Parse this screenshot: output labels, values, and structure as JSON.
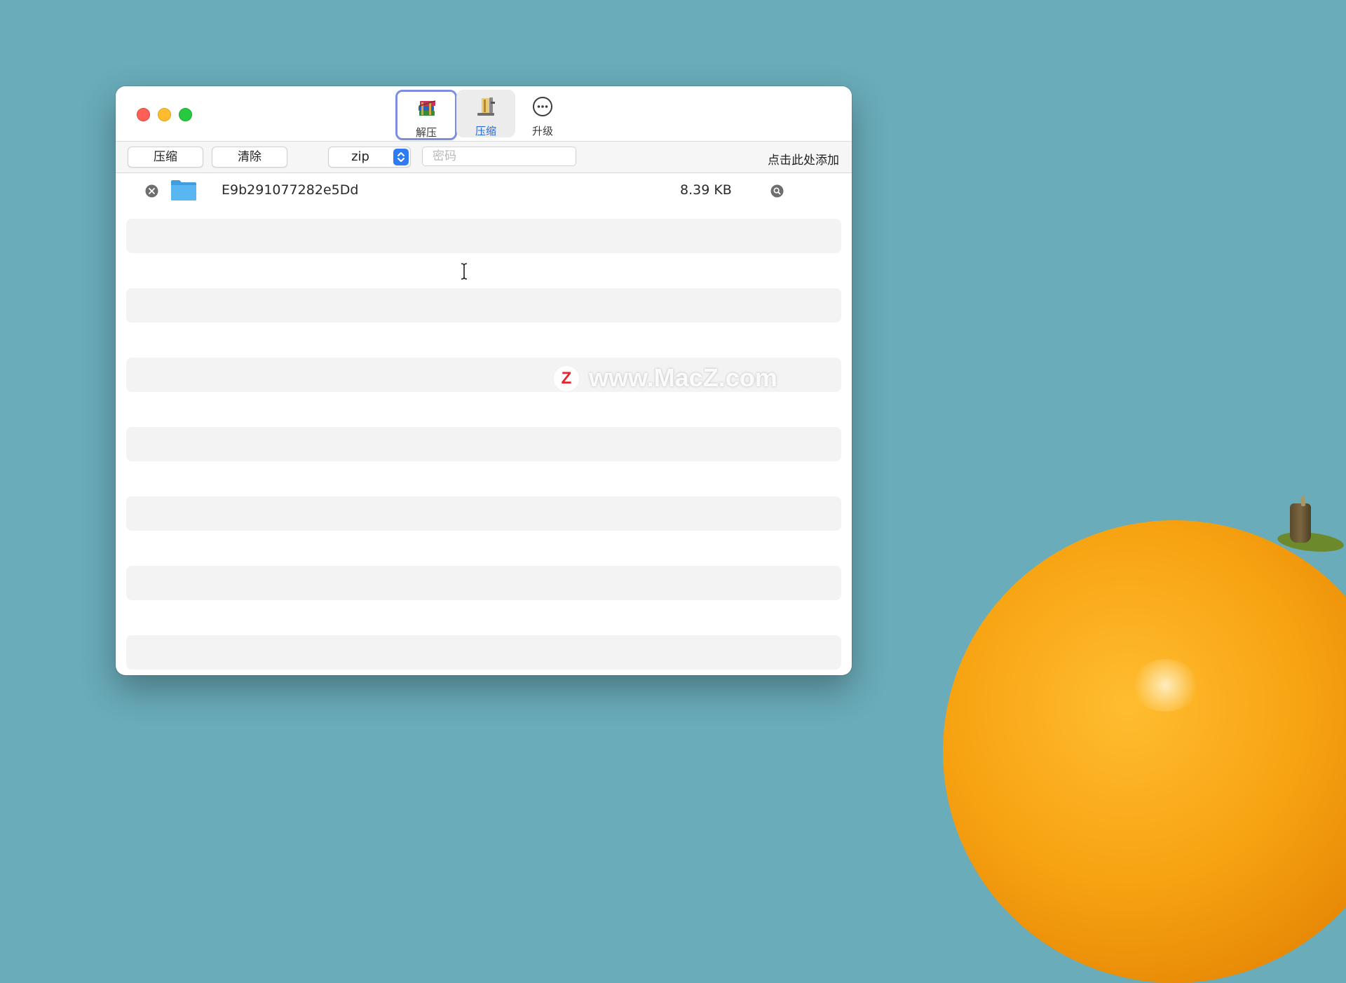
{
  "toolbar_tabs": {
    "extract": {
      "label": "解压",
      "icon": "archive-books-icon"
    },
    "compress": {
      "label": "压缩",
      "icon": "compress-vise-icon"
    },
    "upgrade": {
      "label": "升级",
      "icon": "ellipsis-circle-icon"
    }
  },
  "actions": {
    "compress_label": "压缩",
    "clear_label": "清除",
    "format_selected": "zip",
    "password_placeholder": "密码",
    "add_link": "点击此处添加"
  },
  "files": [
    {
      "name": "E9b291077282e5Dd",
      "size": "8.39 KB",
      "icon": "folder-icon"
    }
  ],
  "watermark": {
    "logo": "Z",
    "text": "www.MacZ.com"
  },
  "colors": {
    "desktop": "#6aacba",
    "accent_blue": "#2f7bf6",
    "selected_tab_border": "#7d8ee0",
    "active_tab_label": "#2d6ad6",
    "folder": "#5ab6f0",
    "close": "#fe5f57",
    "minimize": "#febc2e",
    "zoom": "#28c840",
    "orange": "#f7a312"
  }
}
